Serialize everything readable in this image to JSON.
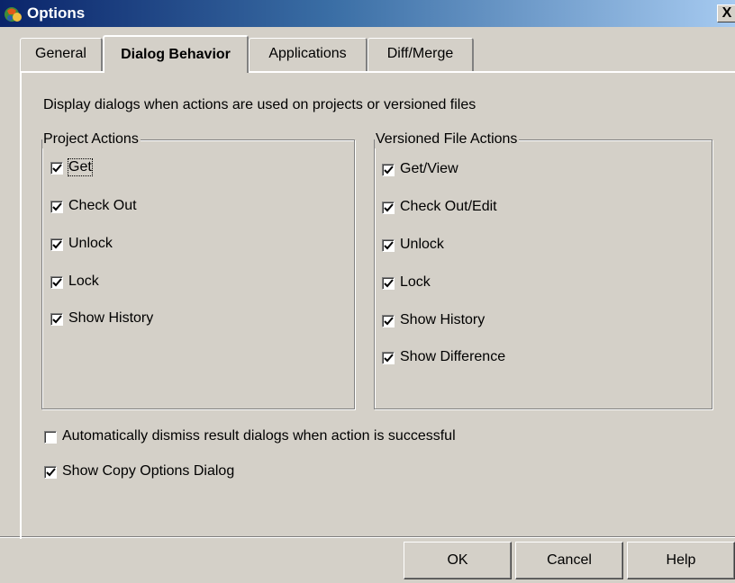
{
  "window": {
    "title": "Options",
    "close_label": "X"
  },
  "tabs": [
    {
      "label": "General",
      "active": false
    },
    {
      "label": "Dialog Behavior",
      "active": true
    },
    {
      "label": "Applications",
      "active": false
    },
    {
      "label": "Diff/Merge",
      "active": false
    }
  ],
  "description": "Display dialogs when actions are used on projects or versioned files",
  "project_actions": {
    "label": "Project Actions",
    "items": [
      {
        "label": "Get",
        "checked": true
      },
      {
        "label": "Check Out",
        "checked": true
      },
      {
        "label": "Unlock",
        "checked": true
      },
      {
        "label": "Lock",
        "checked": true
      },
      {
        "label": "Show History",
        "checked": true
      }
    ]
  },
  "file_actions": {
    "label": "Versioned File Actions",
    "items": [
      {
        "label": "Get/View",
        "checked": true
      },
      {
        "label": "Check Out/Edit",
        "checked": true
      },
      {
        "label": "Unlock",
        "checked": true
      },
      {
        "label": "Lock",
        "checked": true
      },
      {
        "label": "Show History",
        "checked": true
      },
      {
        "label": "Show Difference",
        "checked": true
      }
    ]
  },
  "options": {
    "auto_dismiss": {
      "label": "Automatically dismiss result dialogs when action is successful",
      "checked": false
    },
    "show_copy": {
      "label": "Show Copy Options Dialog",
      "checked": true
    }
  },
  "buttons": {
    "ok": "OK",
    "cancel": "Cancel",
    "help": "Help"
  },
  "colors": {
    "titlebar_start": "#0a246a",
    "titlebar_end": "#a6caf0",
    "face": "#d4d0c8"
  }
}
